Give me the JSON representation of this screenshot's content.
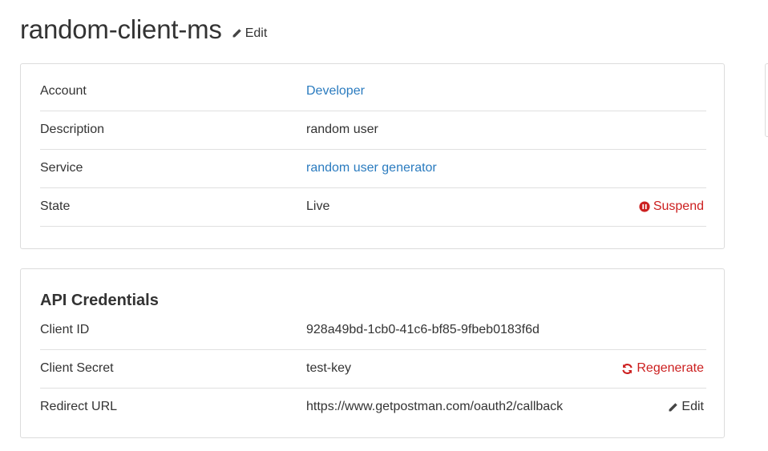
{
  "header": {
    "title": "random-client-ms",
    "edit_label": "Edit"
  },
  "details": {
    "rows": [
      {
        "label": "Account",
        "value": "Developer"
      },
      {
        "label": "Description",
        "value": "random user"
      },
      {
        "label": "Service",
        "value": "random user generator"
      },
      {
        "label": "State",
        "value": "Live",
        "action": "Suspend"
      }
    ]
  },
  "credentials": {
    "title": "API Credentials",
    "rows": [
      {
        "label": "Client ID",
        "value": "928a49bd-1cb0-41c6-bf85-9fbeb0183f6d"
      },
      {
        "label": "Client Secret",
        "value": "test-key",
        "action": "Regenerate"
      },
      {
        "label": "Redirect URL",
        "value": "https://www.getpostman.com/oauth2/callback",
        "action": "Edit"
      }
    ]
  },
  "colors": {
    "link": "#2a7bbf",
    "danger": "#cc1f1f",
    "text": "#333333",
    "border": "#dcdcdc"
  },
  "icons": {
    "title_edit": "pencil-icon",
    "suspend": "pause-circle-icon",
    "regenerate": "refresh-icon",
    "redirect_edit": "pencil-icon"
  }
}
